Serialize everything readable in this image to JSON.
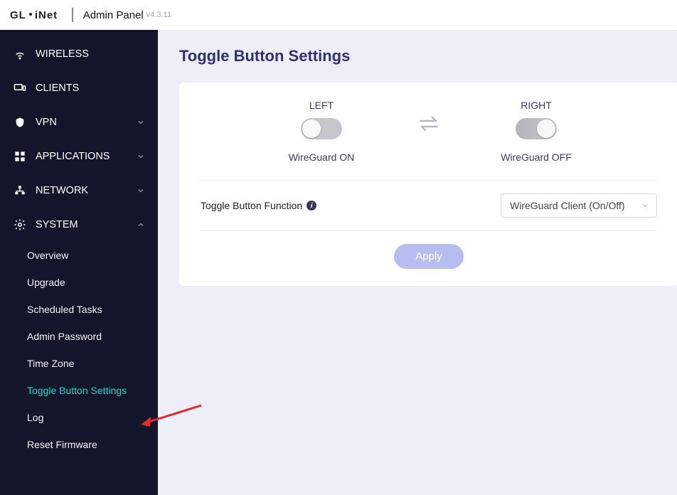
{
  "header": {
    "logo": "GL·iNet",
    "panel": "Admin Panel",
    "version": "v4.3.11"
  },
  "sidebar": {
    "items": [
      {
        "label": "WIRELESS"
      },
      {
        "label": "CLIENTS"
      },
      {
        "label": "VPN"
      },
      {
        "label": "APPLICATIONS"
      },
      {
        "label": "NETWORK"
      },
      {
        "label": "SYSTEM"
      }
    ],
    "system_children": [
      {
        "label": "Overview"
      },
      {
        "label": "Upgrade"
      },
      {
        "label": "Scheduled Tasks"
      },
      {
        "label": "Admin Password"
      },
      {
        "label": "Time Zone"
      },
      {
        "label": "Toggle Button Settings"
      },
      {
        "label": "Log"
      },
      {
        "label": "Reset Firmware"
      }
    ]
  },
  "page": {
    "title": "Toggle Button Settings",
    "left_label": "LEFT",
    "left_sub": "WireGuard ON",
    "right_label": "RIGHT",
    "right_sub": "WireGuard OFF",
    "func_label": "Toggle Button Function",
    "select_value": "WireGuard Client (On/Off)",
    "apply": "Apply"
  }
}
